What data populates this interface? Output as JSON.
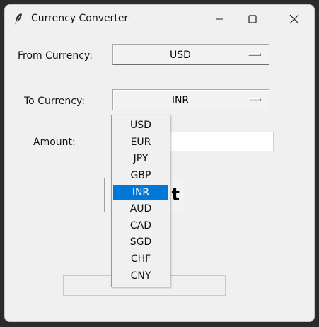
{
  "window": {
    "title": "Currency Converter",
    "minimize_symbol": "—",
    "maximize_symbol": "☐",
    "close_symbol": "✕"
  },
  "form": {
    "from_label": "From Currency:",
    "from_value": "USD",
    "to_label": "To Currency:",
    "to_value": "INR",
    "amount_label": "Amount:",
    "amount_value": "",
    "convert_visible_text": "t",
    "result_value": ""
  },
  "dropdown": {
    "options": [
      "USD",
      "EUR",
      "JPY",
      "GBP",
      "INR",
      "AUD",
      "CAD",
      "SGD",
      "CHF",
      "CNY"
    ],
    "selected": "INR"
  },
  "colors": {
    "selection": "#0078d7",
    "background": "#f0f0f0"
  }
}
